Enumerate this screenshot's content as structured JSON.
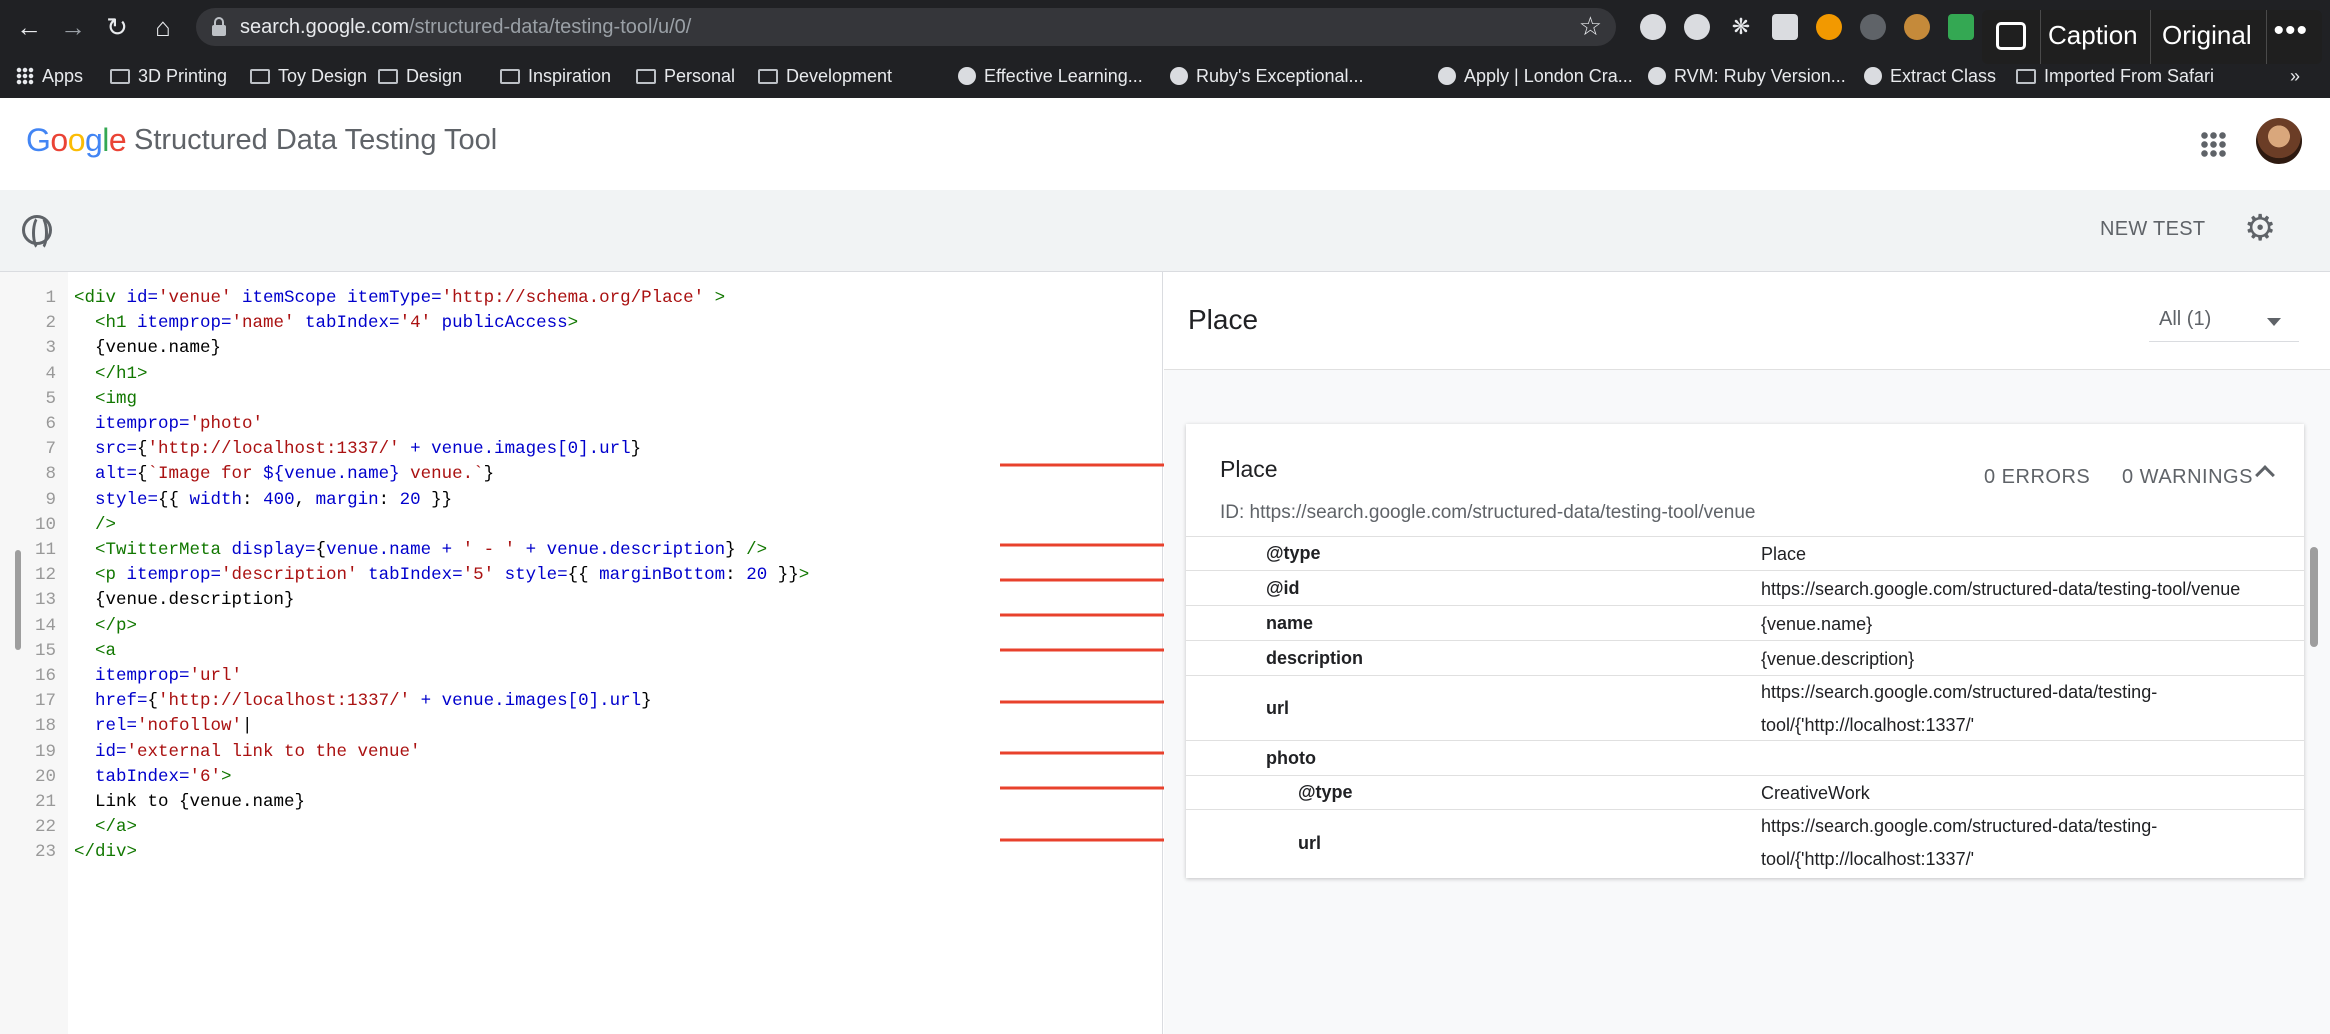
{
  "browser": {
    "url_host": "search.google.com",
    "url_path": "/structured-data/testing-tool/u/0/",
    "caption_overlay": {
      "caption_label": "Caption",
      "original_label": "Original"
    },
    "bookmarks": [
      "Apps",
      "3D Printing",
      "Toy Design",
      "Design",
      "Inspiration",
      "Personal",
      "Development",
      "Effective Learning...",
      "Ruby's Exceptional...",
      "Apply | London Cra...",
      "RVM: Ruby Version...",
      "Extract Class",
      "Imported From Safari"
    ],
    "bookmarks_overflow": "»"
  },
  "header": {
    "logo": [
      "G",
      "o",
      "o",
      "g",
      "l",
      "e"
    ],
    "logo_colors": [
      "#4285F4",
      "#EA4335",
      "#FBBC05",
      "#4285F4",
      "#34A853",
      "#EA4335"
    ],
    "title": "Structured Data Testing Tool"
  },
  "toolbar": {
    "new_test_label": "NEW TEST"
  },
  "code": {
    "lines": [
      [
        [
          "k",
          "<div "
        ],
        [
          "a",
          "id="
        ],
        [
          "s",
          "'venue'"
        ],
        [
          "a",
          " itemScope itemType="
        ],
        [
          "s",
          "'http://schema.org/Place'"
        ],
        [
          "k",
          " >"
        ]
      ],
      [
        [
          "k",
          "  <h1 "
        ],
        [
          "a",
          "itemprop="
        ],
        [
          "s",
          "'name'"
        ],
        [
          "a",
          " tabIndex="
        ],
        [
          "s",
          "'4'"
        ],
        [
          "a",
          " publicAccess"
        ],
        [
          "k",
          ">"
        ]
      ],
      [
        [
          "t",
          "  {venue.name}"
        ]
      ],
      [
        [
          "k",
          "  </h1>"
        ]
      ],
      [
        [
          "k",
          "  <img"
        ]
      ],
      [
        [
          "a",
          "  itemprop="
        ],
        [
          "s",
          "'photo'"
        ]
      ],
      [
        [
          "a",
          "  src="
        ],
        [
          "t",
          "{"
        ],
        [
          "s",
          "'http://localhost:1337/'"
        ],
        [
          "a",
          " + venue.images[0].url"
        ],
        [
          "t",
          "}"
        ]
      ],
      [
        [
          "a",
          "  alt="
        ],
        [
          "t",
          "{"
        ],
        [
          "s",
          "`Image for "
        ],
        [
          "a",
          "${venue.name}"
        ],
        [
          "s",
          " venue.`"
        ],
        [
          "t",
          "}"
        ]
      ],
      [
        [
          "a",
          "  style="
        ],
        [
          "t",
          "{{ "
        ],
        [
          "a",
          "width"
        ],
        [
          "t",
          ": "
        ],
        [
          "a",
          "400"
        ],
        [
          "t",
          ", "
        ],
        [
          "a",
          "margin"
        ],
        [
          "t",
          ": "
        ],
        [
          "a",
          "20"
        ],
        [
          "t",
          " }}"
        ]
      ],
      [
        [
          "k",
          "  />"
        ]
      ],
      [
        [
          "k",
          "  <TwitterMeta "
        ],
        [
          "a",
          "display="
        ],
        [
          "t",
          "{"
        ],
        [
          "a",
          "venue.name + "
        ],
        [
          "s",
          "' - '"
        ],
        [
          "a",
          " + venue.description"
        ],
        [
          "t",
          "}"
        ],
        [
          "k",
          " />"
        ]
      ],
      [
        [
          "k",
          "  <p "
        ],
        [
          "a",
          "itemprop="
        ],
        [
          "s",
          "'description'"
        ],
        [
          "a",
          " tabIndex="
        ],
        [
          "s",
          "'5'"
        ],
        [
          "a",
          " style="
        ],
        [
          "t",
          "{{ "
        ],
        [
          "a",
          "marginBottom"
        ],
        [
          "t",
          ": "
        ],
        [
          "a",
          "20"
        ],
        [
          "t",
          " }}"
        ],
        [
          "k",
          ">"
        ]
      ],
      [
        [
          "t",
          "  {venue.description}"
        ]
      ],
      [
        [
          "k",
          "  </p>"
        ]
      ],
      [
        [
          "k",
          "  <a"
        ]
      ],
      [
        [
          "a",
          "  itemprop="
        ],
        [
          "s",
          "'url'"
        ]
      ],
      [
        [
          "a",
          "  href="
        ],
        [
          "t",
          "{"
        ],
        [
          "s",
          "'http://localhost:1337/'"
        ],
        [
          "a",
          " + venue.images[0].url"
        ],
        [
          "t",
          "}"
        ]
      ],
      [
        [
          "a",
          "  rel="
        ],
        [
          "s",
          "'nofollow'"
        ],
        [
          "t",
          "|"
        ]
      ],
      [
        [
          "a",
          "  id="
        ],
        [
          "s",
          "'external link to the venue'"
        ]
      ],
      [
        [
          "a",
          "  tabIndex="
        ],
        [
          "s",
          "'6'"
        ],
        [
          "k",
          ">"
        ]
      ],
      [
        [
          "t",
          "  Link to {venue.name}"
        ]
      ],
      [
        [
          "k",
          "  </a>"
        ]
      ],
      [
        [
          "k",
          "</div>"
        ]
      ]
    ]
  },
  "results": {
    "title": "Place",
    "filter_label": "All (1)",
    "card": {
      "title": "Place",
      "errors": "0 ERRORS",
      "warnings": "0 WARNINGS",
      "id_line": "ID: https://search.google.com/structured-data/testing-tool/venue",
      "props": [
        {
          "key": "@type",
          "value": "Place",
          "indent": 0
        },
        {
          "key": "@id",
          "value": "https://search.google.com/structured-data/testing-tool/venue",
          "indent": 0
        },
        {
          "key": "name",
          "value": "{venue.name}",
          "indent": 0
        },
        {
          "key": "description",
          "value": "{venue.description}",
          "indent": 0
        },
        {
          "key": "url",
          "value": "https://search.google.com/structured-data/testing-tool/{'http://localhost:1337/'",
          "indent": 0
        },
        {
          "key": "photo",
          "value": "",
          "indent": 0
        },
        {
          "key": "@type",
          "value": "CreativeWork",
          "indent": 1
        },
        {
          "key": "url",
          "value": "https://search.google.com/structured-data/testing-tool/{'http://localhost:1337/'",
          "indent": 1
        }
      ]
    }
  },
  "annotation_color": "#e8412c"
}
